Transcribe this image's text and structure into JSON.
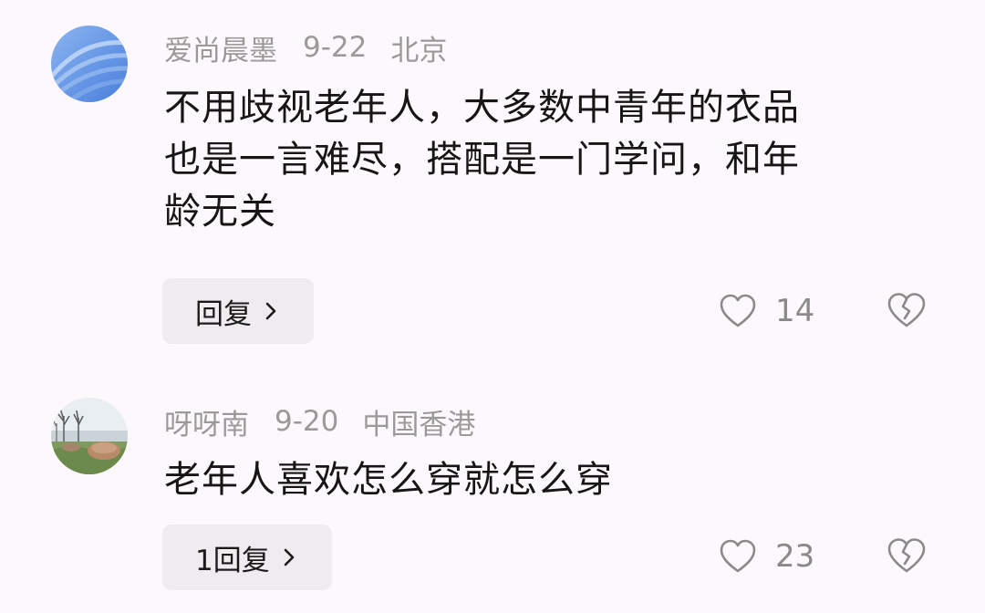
{
  "comments": [
    {
      "username": "爱尚晨墨",
      "date": "9-22",
      "location": "北京",
      "lines": [
        "不用歧视老年人，大多数中青年的衣品",
        "也是一言难尽，搭配是一门学问，和年",
        "龄无关"
      ],
      "reply_label": "回复",
      "likes": "14",
      "avatar_icon": "blue-wave-avatar"
    },
    {
      "username": "呀呀南",
      "date": "9-20",
      "location": "中国香港",
      "lines": [
        "老年人喜欢怎么穿就怎么穿"
      ],
      "reply_label": "1回复",
      "likes": "23",
      "avatar_icon": "lakeside-photo-avatar"
    }
  ],
  "icons": {
    "like": "heart-outline-icon",
    "dislike": "broken-heart-icon",
    "chevron": "chevron-right-icon"
  },
  "colors": {
    "background": "#fcf8fc",
    "meta_text": "#9a9a9a",
    "reply_bg": "#efebef",
    "icon_gray": "#8a8a8a"
  }
}
